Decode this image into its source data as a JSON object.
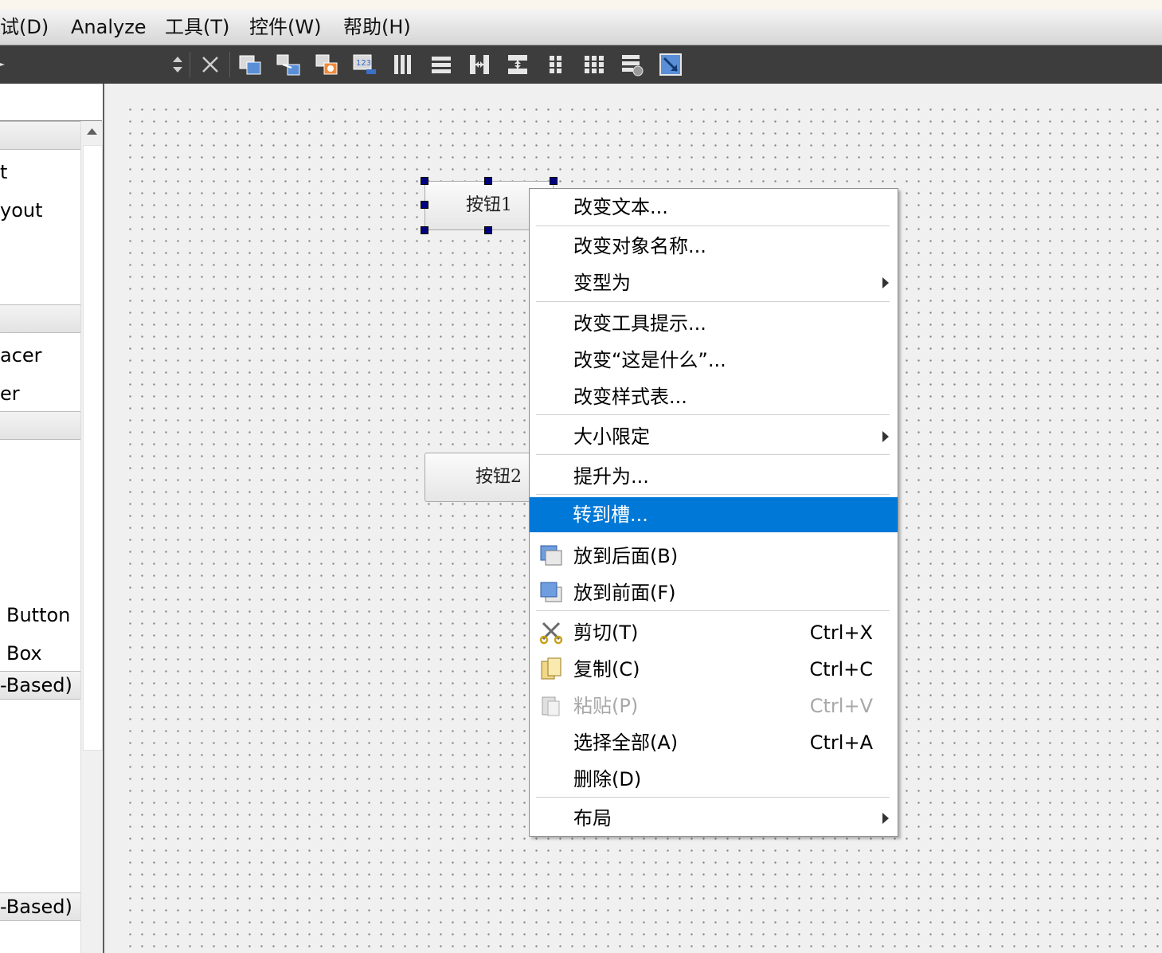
{
  "menubar": {
    "items": [
      "试(D)",
      "Analyze",
      "工具(T)",
      "控件(W)",
      "帮助(H)"
    ]
  },
  "toolbar": {
    "icons": [
      "sort-arrows-icon",
      "close-icon",
      "edit-widgets-icon",
      "edit-signals-slots-icon",
      "edit-buddies-icon",
      "edit-tab-order-icon",
      "layout-horizontal-icon",
      "layout-vertical-icon",
      "layout-horizontal-splitter-icon",
      "layout-vertical-splitter-icon",
      "layout-form-icon",
      "layout-grid-icon",
      "break-layout-icon",
      "adjust-size-icon"
    ]
  },
  "widget_box": {
    "items": [
      {
        "text": "t"
      },
      {
        "text": "yout"
      },
      {
        "text": "acer"
      },
      {
        "text": "er"
      },
      {
        "text": "Button"
      },
      {
        "text": "Box"
      }
    ],
    "categories": [
      "-Based)",
      "-Based)"
    ]
  },
  "form": {
    "button1_label": "按钮1",
    "button2_label": "按钮2"
  },
  "context_menu": {
    "items": [
      {
        "label": "改变文本..."
      },
      {
        "label": "改变对象名称..."
      },
      {
        "label": "变型为"
      },
      {
        "label": "改变工具提示..."
      },
      {
        "label": "改变“这是什么”..."
      },
      {
        "label": "改变样式表..."
      },
      {
        "label": "大小限定"
      },
      {
        "label": "提升为..."
      },
      {
        "label": "转到槽..."
      },
      {
        "label": "放到后面(B)"
      },
      {
        "label": "放到前面(F)"
      },
      {
        "label": "剪切(T)",
        "shortcut": "Ctrl+X"
      },
      {
        "label": "复制(C)",
        "shortcut": "Ctrl+C"
      },
      {
        "label": "粘贴(P)",
        "shortcut": "Ctrl+V"
      },
      {
        "label": "选择全部(A)",
        "shortcut": "Ctrl+A"
      },
      {
        "label": "删除(D)"
      },
      {
        "label": "布局"
      }
    ],
    "highlight_color": "#0078d7"
  }
}
